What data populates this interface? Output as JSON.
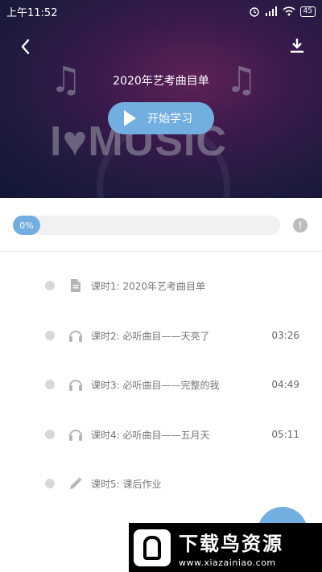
{
  "status_bar": {
    "time": "上午11:52",
    "battery": "45"
  },
  "hero": {
    "title": "2020年艺考曲目单",
    "start_button_label": "开始学习",
    "background_text": "I♥MUSIC"
  },
  "progress": {
    "percent_label": "0%",
    "value": 0
  },
  "lessons": [
    {
      "icon": "document-icon",
      "title": "课时1: 2020年艺考曲目单",
      "duration": ""
    },
    {
      "icon": "headphones-icon",
      "title": "课时2: 必听曲目——天亮了",
      "duration": "03:26"
    },
    {
      "icon": "headphones-icon",
      "title": "课时3: 必听曲目——完整的我",
      "duration": "04:49"
    },
    {
      "icon": "headphones-icon",
      "title": "课时4: 必听曲目——五月天",
      "duration": "05:11"
    },
    {
      "icon": "pencil-icon",
      "title": "课时5: 课后作业",
      "duration": ""
    }
  ],
  "watermark": {
    "title": "下载鸟资源",
    "url": "www.xiazainiao.com"
  },
  "colors": {
    "accent": "#73aee0",
    "text_muted": "#777777"
  }
}
